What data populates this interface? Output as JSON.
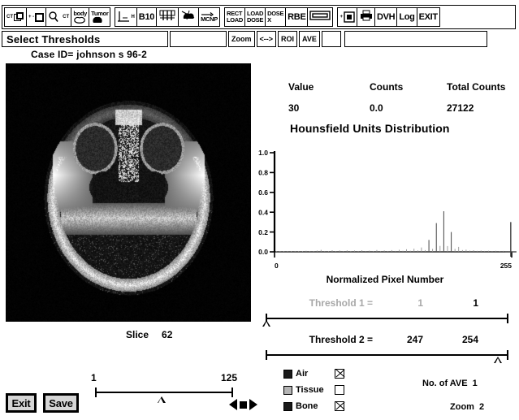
{
  "toolbar": {
    "groups": [
      {
        "name": "image-tools",
        "buttons": [
          {
            "name": "ct-copy-button",
            "label": "CT",
            "sub": "CT",
            "icon": "copy-icon"
          },
          {
            "name": "add-remove-button",
            "label": "+ -",
            "sub": "",
            "icon": "square-icon"
          },
          {
            "name": "zoom-ct-button",
            "label": "",
            "sub": "CT",
            "icon": "magnifier-icon"
          },
          {
            "name": "body-contour-button",
            "label": "body",
            "sub": "",
            "icon": "body-outline-icon"
          },
          {
            "name": "tumor-button",
            "label": "Tumor",
            "sub": "",
            "icon": "tumor-shape-icon"
          }
        ]
      },
      {
        "name": "beam-tools",
        "buttons": [
          {
            "name": "axis-h-button",
            "label": "",
            "sub": "H",
            "icon": "axis-icon"
          },
          {
            "name": "b10-button",
            "label": "B10",
            "sub": "",
            "icon": ""
          },
          {
            "name": "collimator-button",
            "label": "",
            "sub": "",
            "icon": "collimator-icon"
          },
          {
            "name": "patient-beam-button",
            "label": "",
            "sub": "",
            "icon": "patient-beam-icon"
          },
          {
            "name": "mcnp-button",
            "label": "MCNP",
            "sub": "",
            "icon": "arrow-right-icon"
          }
        ]
      },
      {
        "name": "dose-tools",
        "buttons": [
          {
            "name": "rect-load-button",
            "line1": "RECT",
            "line2": "LOAD"
          },
          {
            "name": "load-dose-button",
            "line1": "LOAD",
            "line2": "DOSE"
          },
          {
            "name": "dose-x-button",
            "line1": "DOSE",
            "line2": "X"
          },
          {
            "name": "rbe-button",
            "line1": "RBE",
            "line2": ""
          },
          {
            "name": "colorbar-button",
            "line1": "",
            "line2": "",
            "icon": "colorbar-icon"
          }
        ]
      },
      {
        "name": "output-tools",
        "buttons": [
          {
            "name": "export-button",
            "label": "",
            "icon": "export-icon"
          },
          {
            "name": "print-button",
            "label": "",
            "icon": "printer-icon"
          },
          {
            "name": "dvh-button",
            "label": "DVH",
            "icon": ""
          },
          {
            "name": "log-button",
            "label": "Log",
            "icon": ""
          },
          {
            "name": "exit-toolbar-button",
            "label": "EXIT",
            "icon": ""
          }
        ]
      }
    ]
  },
  "status_bar": {
    "title": "Select Thresholds",
    "buttons": [
      {
        "name": "zoom-mode-button",
        "label": "Zoom"
      },
      {
        "name": "pan-mode-button",
        "label": "<-->"
      },
      {
        "name": "roi-mode-button",
        "label": "ROI"
      },
      {
        "name": "ave-mode-button",
        "label": "AVE"
      }
    ]
  },
  "case": {
    "id_label": "Case ID= johnson s 96-2"
  },
  "stats": {
    "headers": [
      "Value",
      "Counts",
      "Total Counts"
    ],
    "values": [
      "30",
      "0.0",
      "27122"
    ]
  },
  "chart_data": {
    "type": "bar",
    "title": "Hounsfield Units Distribution",
    "xlabel": "Normalized Pixel Number",
    "ylabel": "",
    "xlim": [
      0,
      255
    ],
    "ylim": [
      0,
      1.0
    ],
    "xticklabels": [
      "0",
      "255"
    ],
    "yticklabels": [
      "0.0",
      "0.2",
      "0.4",
      "0.6",
      "0.8",
      "1.0"
    ],
    "ytickvalues": [
      0.0,
      0.2,
      0.4,
      0.6,
      0.8,
      1.0
    ],
    "grid": false,
    "legend": "none",
    "categories": [
      2,
      6,
      10,
      14,
      18,
      22,
      26,
      30,
      34,
      38,
      42,
      46,
      50,
      54,
      58,
      62,
      66,
      70,
      74,
      78,
      82,
      86,
      90,
      94,
      98,
      102,
      106,
      110,
      114,
      118,
      122,
      126,
      130,
      134,
      138,
      142,
      146,
      150,
      154,
      158,
      162,
      166,
      170,
      174,
      178,
      182,
      186,
      190,
      194,
      198,
      202,
      206,
      210,
      214,
      218,
      222,
      226,
      230,
      234,
      238,
      242,
      246,
      250,
      254
    ],
    "values": [
      0.006,
      0.004,
      0.004,
      0.005,
      0.004,
      0.006,
      0.005,
      0.004,
      0.01,
      0.006,
      0.005,
      0.013,
      0.02,
      0.008,
      0.006,
      0.016,
      0.006,
      0.014,
      0.007,
      0.015,
      0.006,
      0.013,
      0.006,
      0.016,
      0.008,
      0.012,
      0.007,
      0.018,
      0.008,
      0.014,
      0.007,
      0.017,
      0.009,
      0.021,
      0.01,
      0.026,
      0.011,
      0.032,
      0.014,
      0.044,
      0.017,
      0.12,
      0.03,
      0.29,
      0.06,
      0.41,
      0.058,
      0.2,
      0.03,
      0.05,
      0.018,
      0.022,
      0.012,
      0.016,
      0.01,
      0.013,
      0.009,
      0.011,
      0.008,
      0.01,
      0.007,
      0.009,
      0.006,
      0.3
    ]
  },
  "threshold1": {
    "label": "Threshold 1 =",
    "value_low": "1",
    "value_high": "1",
    "slider_position_pct": 0,
    "enabled": false
  },
  "threshold2": {
    "label": "Threshold 2 =",
    "value_low": "247",
    "value_high": "254",
    "slider_position_pct": 96,
    "enabled": true
  },
  "slice": {
    "label": "Slice",
    "value": "62",
    "min": "1",
    "max": "125",
    "slider_position_pct": 48
  },
  "actions": {
    "exit_label": "Exit",
    "save_label": "Save"
  },
  "legend": {
    "items": [
      {
        "name": "Air",
        "swatch_color": "#1a1a1a",
        "checked": true
      },
      {
        "name": "Tissue",
        "swatch_color": "#b4b4b4",
        "checked": false
      },
      {
        "name": "Bone",
        "swatch_color": "#1a1a1a",
        "checked": true
      }
    ]
  },
  "readouts": {
    "ave_label": "No. of AVE",
    "ave_value": "1",
    "zoom_label": "Zoom",
    "zoom_value": "2"
  }
}
